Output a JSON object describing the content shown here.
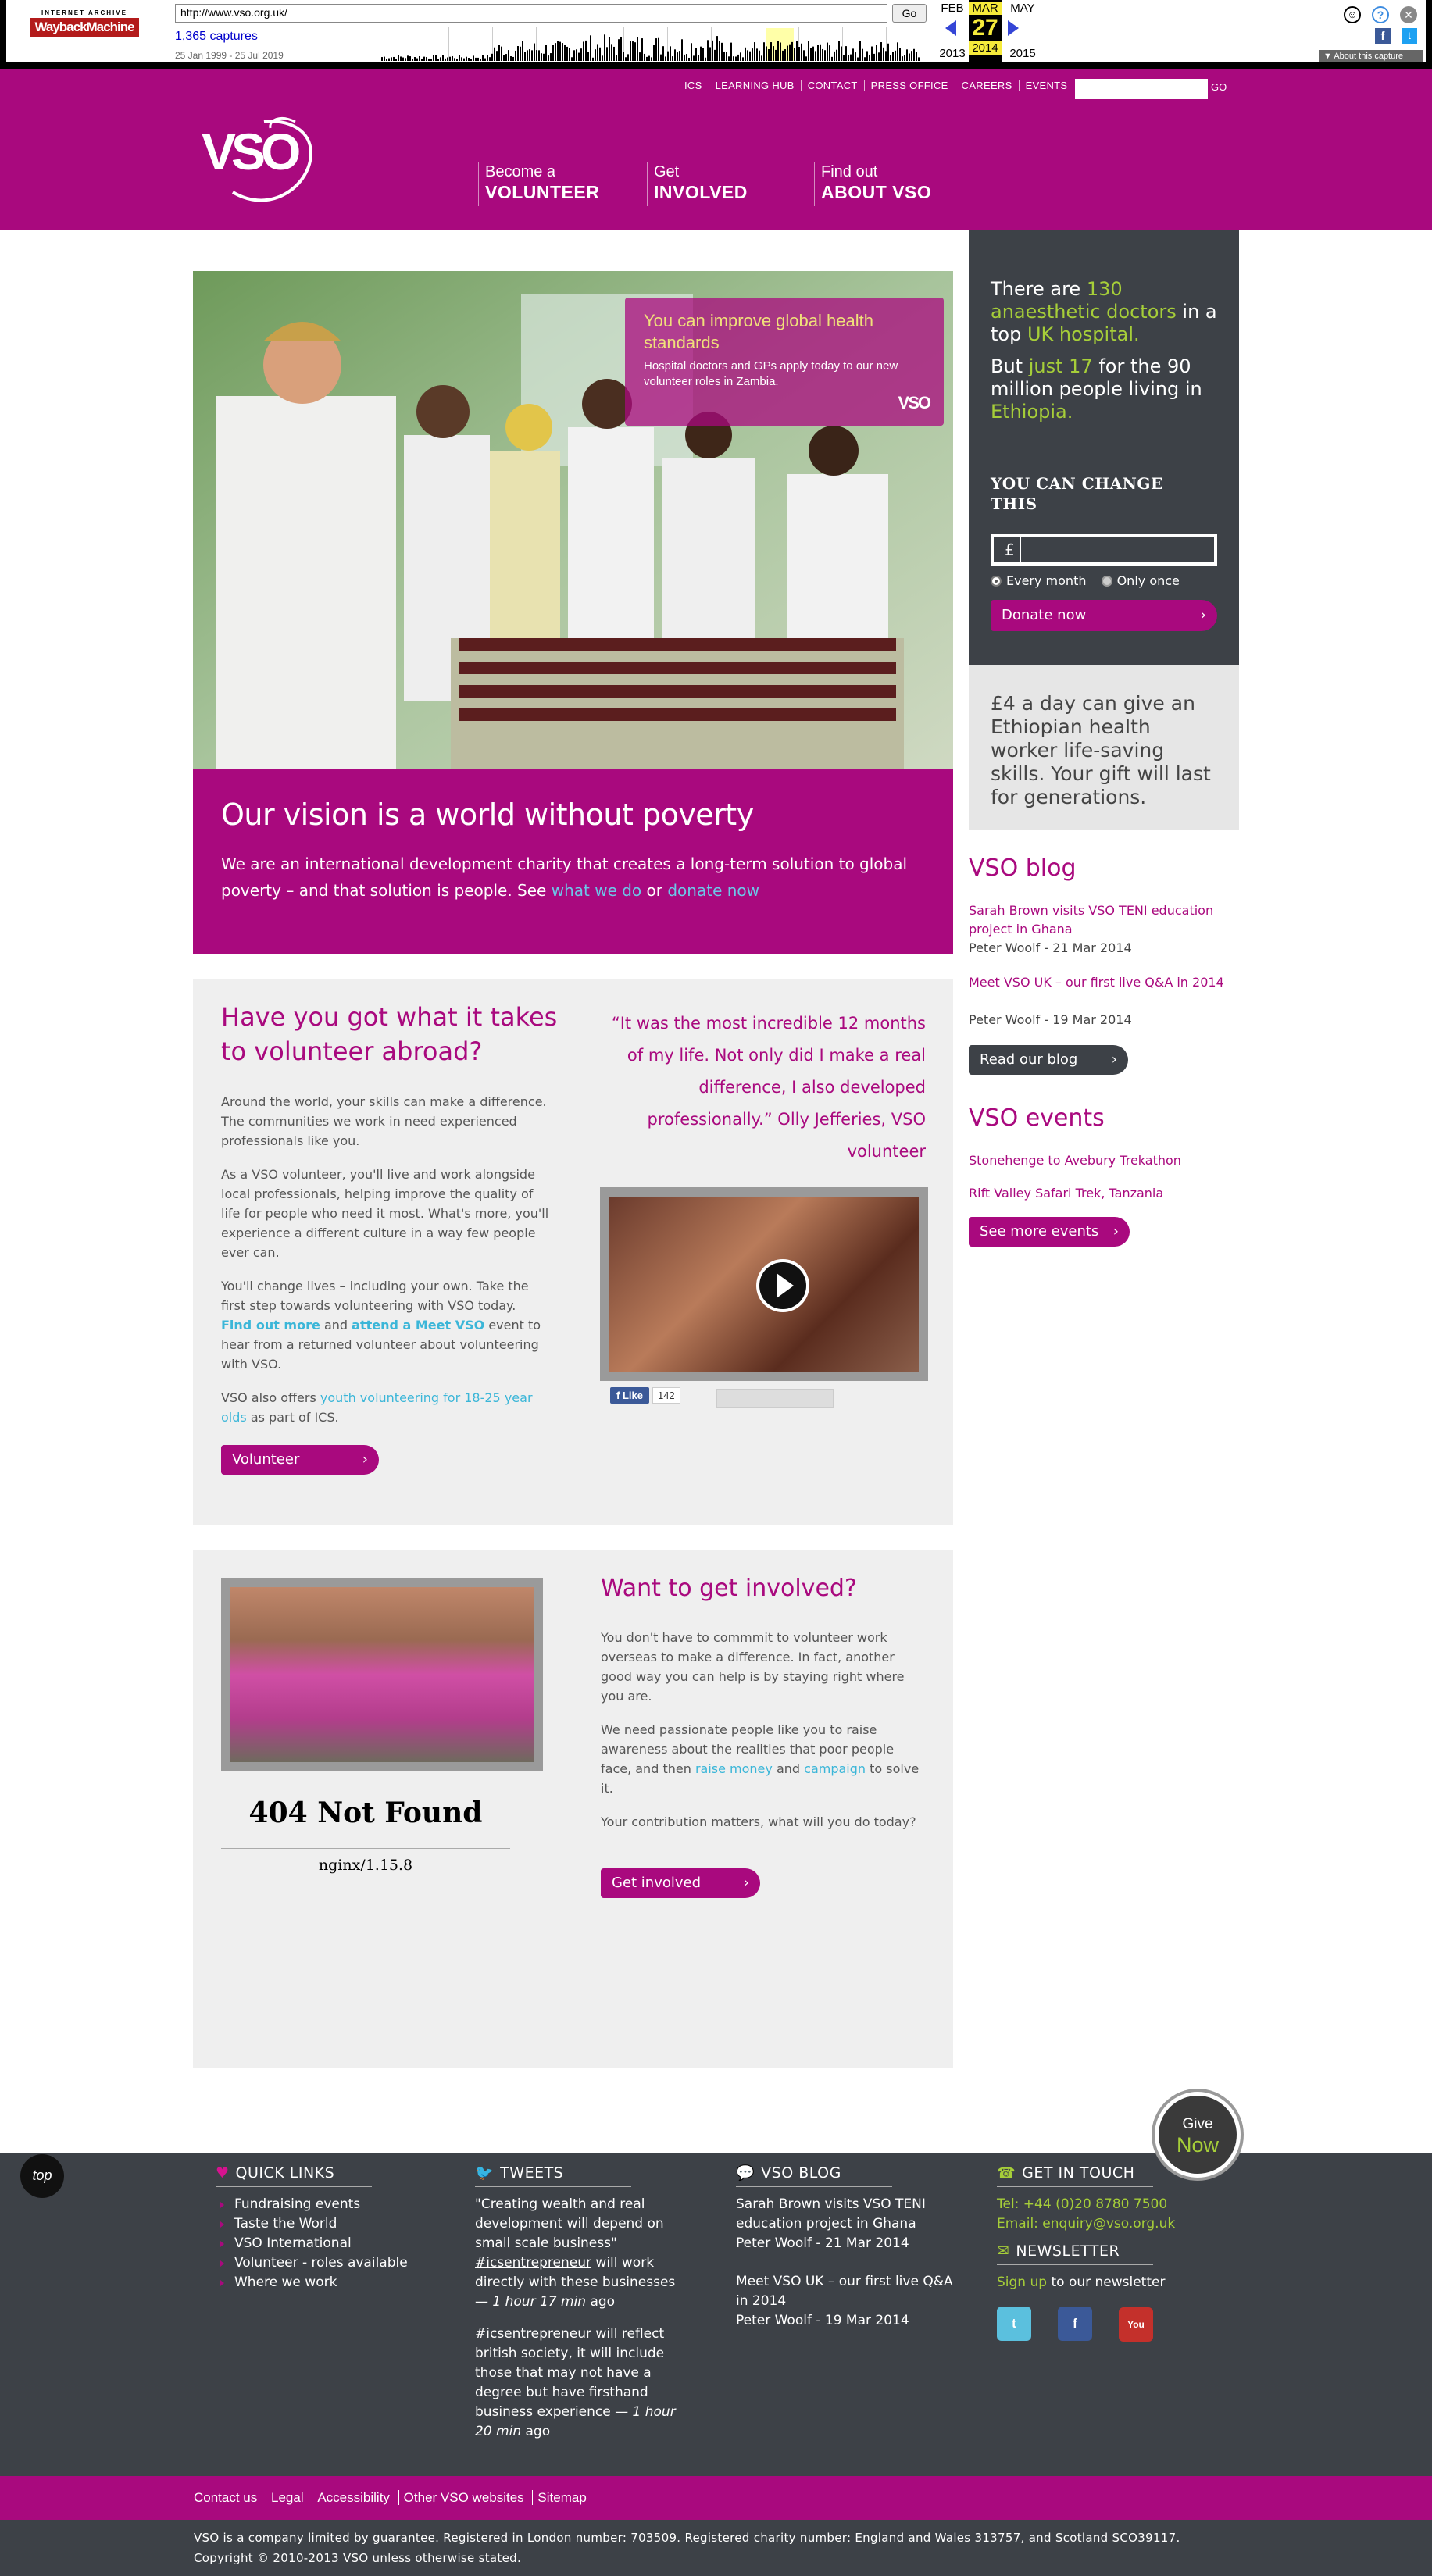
{
  "wayback": {
    "logo_top": "INTERNET ARCHIVE",
    "logo_main": "WaybackMachine",
    "url": "http://www.vso.org.uk/",
    "go": "Go",
    "captures": "1,365 captures",
    "range": "25 Jan 1999 - 25 Jul 2019",
    "prev_month": "FEB",
    "cur_month": "MAR",
    "next_month": "MAY",
    "day": "27",
    "prev_year": "2013",
    "cur_year": "2014",
    "next_year": "2015",
    "about": "About this capture"
  },
  "topnav": [
    "ICS",
    "LEARNING HUB",
    "CONTACT",
    "PRESS OFFICE",
    "CAREERS",
    "EVENTS"
  ],
  "search_go": "GO",
  "logo": "VSO",
  "mainnav": [
    {
      "small": "Become a",
      "big": "VOLUNTEER"
    },
    {
      "small": "Get",
      "big": "INVOLVED"
    },
    {
      "small": "Find out",
      "big": "ABOUT VSO"
    }
  ],
  "give": {
    "g": "Give",
    "n": "Now"
  },
  "hero": {
    "headline": "You can improve global health standards",
    "text": "Hospital doctors and GPs apply today to our new volunteer roles in Zambia."
  },
  "vision": {
    "title": "Our vision is a world without poverty",
    "text": "We are an international development charity that creates a long-term solution to global poverty – and that solution is people. See",
    "link1": "what we do",
    "or": "or",
    "link2": "donate now"
  },
  "donate": {
    "s1a": "There are ",
    "s1b": "130 anaesthetic doctors",
    "s1c": " in a top ",
    "s1d": "UK hospital.",
    "s2a": "But ",
    "s2b": "just 17",
    "s2c": " for the 90 million people living in ",
    "s2d": "Ethiopia.",
    "you_can": "YOU CAN CHANGE THIS",
    "currency": "£",
    "every": "Every month",
    "once": "Only once",
    "button": "Donate now",
    "gift": "£4 a day can give an Ethiopian health worker life-saving skills. Your gift will last for generations."
  },
  "blog": {
    "title": "VSO blog",
    "items": [
      {
        "title": "Sarah Brown visits VSO TENI education project in Ghana",
        "meta": "Peter Woolf - 21 Mar 2014"
      },
      {
        "title": "Meet VSO UK – our first live Q&A in 2014",
        "meta": "Peter Woolf - 19 Mar 2014"
      }
    ],
    "button": "Read our blog"
  },
  "events": {
    "title": "VSO events",
    "items": [
      "Stonehenge to Avebury Trekathon",
      "Rift Valley Safari Trek, Tanzania"
    ],
    "button": "See more events"
  },
  "volunteer": {
    "title": "Have you got what it takes to volunteer abroad?",
    "p1": "Around the world, your skills can make a difference. The communities we work in need experienced professionals like you.",
    "p2": "As a VSO volunteer, you'll live and work alongside local professionals, helping improve the quality of life for people who need it most. What's more, you'll experience a different culture in a way few people ever can.",
    "p3a": "You'll change lives – including your own. Take the first step towards volunteering with VSO today.",
    "p3link1": "Find out more",
    "p3and": "and",
    "p3link2": "attend a Meet VSO",
    "p3b": "event to hear from a returned volunteer about volunteering with VSO.",
    "p4a": "VSO also offers",
    "p4link": "youth volunteering for 18-25 year olds",
    "p4b": "as part of ICS.",
    "button": "Volunteer",
    "quote": "“It was the most incredible 12 months of my life. Not only did I make a real difference, I also developed professionally.” Olly Jefferies, VSO volunteer",
    "like": "Like",
    "like_count": "142"
  },
  "involved": {
    "nf_title": "404 Not Found",
    "nf_server": "nginx/1.15.8",
    "title": "Want to get involved?",
    "p1": "You don't have to commmit to volunteer work overseas to make a difference. In fact, another good way you can help is by staying right where you are.",
    "p2a": "We need passionate people like you to raise awareness about the realities that poor people face, and then",
    "p2link1": "raise money",
    "p2and": "and",
    "p2link2": "campaign",
    "p2b": "to solve it.",
    "p3": "Your contribution matters, what will you do today?",
    "button": "Get involved"
  },
  "footer": {
    "top": "top",
    "quick_title": "QUICK LINKS",
    "quick": [
      "Fundraising events",
      "Taste the World",
      "VSO International",
      "Volunteer - roles available",
      "Where we work"
    ],
    "tweets_title": "TWEETS",
    "tweet1a": "\"Creating wealth and real development will depend on small scale business\"",
    "tweet1tag": "#icsentrepreneur",
    "tweet1b": "will work directly with these businesses —",
    "tweet1time": "1 hour 17 min",
    "tweet1c": "ago",
    "tweet2tag": "#icsentrepreneur",
    "tweet2b": "will reflect british society, it will include those that may not have a degree but have firsthand business experience —",
    "tweet2time": "1 hour 20 min",
    "tweet2c": "ago",
    "blog_title": "VSO BLOG",
    "blog1": "Sarah Brown visits VSO TENI education project in Ghana",
    "blog1meta": "Peter Woolf - 21 Mar 2014",
    "blog2": "Meet VSO UK – our first live Q&A in 2014",
    "blog2meta": "Peter Woolf - 19 Mar 2014",
    "contact_title": "GET IN TOUCH",
    "tel": "Tel: +44 (0)20 8780 7500",
    "email": "Email: enquiry@vso.org.uk",
    "news_title": "NEWSLETTER",
    "signup": "Sign up",
    "signup_rest": "to our newsletter",
    "bottom_links": [
      "Contact us",
      "Legal",
      "Accessibility",
      "Other VSO websites",
      "Sitemap"
    ],
    "legal1": "VSO is a company limited by guarantee. Registered in London number: 703509. Registered charity number: England and Wales 313757, and Scotland SCO39117.",
    "legal2": "Copyright © 2010-2013 VSO unless otherwise stated."
  },
  "colors": {
    "magenta": "#a9097e",
    "dark": "#3d4147",
    "green": "#a6ce39",
    "link": "#3bb6d8"
  }
}
